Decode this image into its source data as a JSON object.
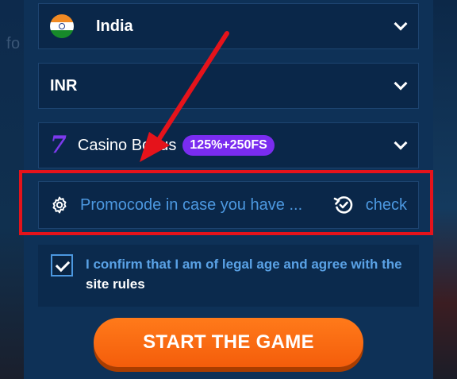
{
  "background": {
    "partial_text": "fo"
  },
  "country": {
    "label": "India",
    "flag_icon": "india-flag-icon"
  },
  "currency": {
    "label": "INR"
  },
  "bonus": {
    "label": "Casino Bonus",
    "badge": "125%+250FS",
    "icon": "seven-icon"
  },
  "promo": {
    "placeholder": "Promocode in case you have ...",
    "check_label": "check"
  },
  "confirm": {
    "text_blue": "I confirm that I am of legal age and agree with the",
    "text_white": "site rules",
    "checked": true
  },
  "start_button": {
    "label": "START THE GAME"
  },
  "colors": {
    "accent_orange": "#f46a10",
    "badge_purple": "#7a2cf0",
    "highlight_red": "#e5131b",
    "link_blue": "#4c98e0"
  }
}
